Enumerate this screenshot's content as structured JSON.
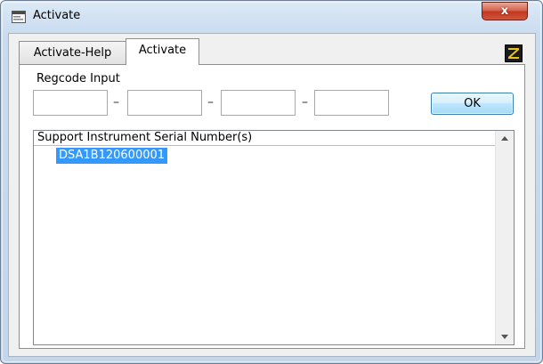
{
  "window": {
    "title": "Activate",
    "close_glyph": "x"
  },
  "tabs": [
    {
      "label": "Activate-Help",
      "active": false
    },
    {
      "label": "Activate",
      "active": true
    }
  ],
  "regcode": {
    "label": "Regcode Input",
    "fields": [
      "",
      "",
      "",
      ""
    ],
    "separator": "–"
  },
  "ok_button": {
    "label": "OK"
  },
  "serial_list": {
    "header": "Support Instrument Serial Number(s)",
    "items": [
      {
        "value": "DSA1B120600001",
        "selected": true
      }
    ]
  },
  "colors": {
    "selection": "#3399ff",
    "close_button": "#c0391f",
    "title_gradient_top": "#dce9f7"
  },
  "icons": {
    "app": "window-app-icon",
    "close": "close-icon",
    "logo": "z-logo-icon",
    "scroll_up": "scroll-up-arrow-icon",
    "scroll_down": "scroll-down-arrow-icon"
  }
}
